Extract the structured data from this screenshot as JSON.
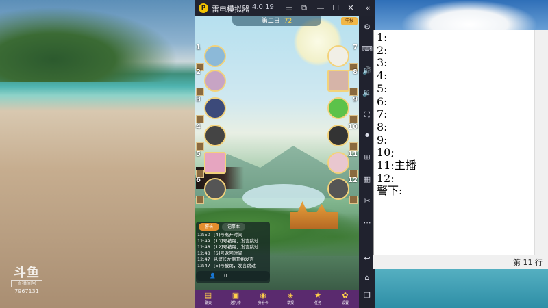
{
  "watermark": {
    "logo": "斗鱼",
    "sub": "直播间号",
    "room_id": "7967131"
  },
  "emulator": {
    "title": "雷电模拟器",
    "version": "4.0.19",
    "sidebar_icons": [
      "gear-icon",
      "keyboard-icon",
      "volume-up-icon",
      "volume-down-icon",
      "fullscreen-icon",
      "record-icon",
      "add-icon",
      "apk-icon",
      "scissors-icon",
      "more-icon",
      "back-icon",
      "home-icon",
      "recents-icon"
    ]
  },
  "game": {
    "day_label": "第二日",
    "timer": "72",
    "corner_label": "申报",
    "seats_left": [
      "1",
      "2",
      "3",
      "4",
      "5",
      "6"
    ],
    "seats_right": [
      "7",
      "8",
      "9",
      "10",
      "11",
      "12"
    ],
    "log_tabs": [
      "警长",
      "记事本"
    ],
    "log": [
      {
        "time": "12:50",
        "text": "[4]号离开时间"
      },
      {
        "time": "12:49",
        "text": "[10]号被踢，发言跳过"
      },
      {
        "time": "12:48",
        "text": "[12]号被踢，发言跳过"
      },
      {
        "time": "12:48",
        "text": "[6]号返回时间"
      },
      {
        "time": "12:47",
        "text": "从警长左侧开始发言"
      },
      {
        "time": "12:47",
        "text": "[5]号被踢，发言跳过"
      }
    ],
    "input_count": "0",
    "nav": [
      {
        "icon": "chat-icon",
        "label": "聊天"
      },
      {
        "icon": "gift-icon",
        "label": "送礼物"
      },
      {
        "icon": "card-icon",
        "label": "身份卡"
      },
      {
        "icon": "report-icon",
        "label": "举报"
      },
      {
        "icon": "mission-icon",
        "label": "任务"
      },
      {
        "icon": "gear-icon",
        "label": "设置"
      }
    ]
  },
  "notepad": {
    "lines": [
      "1:",
      "2:",
      "3:",
      "4:",
      "5:",
      "6:",
      "7:",
      "8:",
      "9:",
      "10;",
      "11:主播",
      "12:",
      "警下:"
    ],
    "status": "第 11 行"
  }
}
